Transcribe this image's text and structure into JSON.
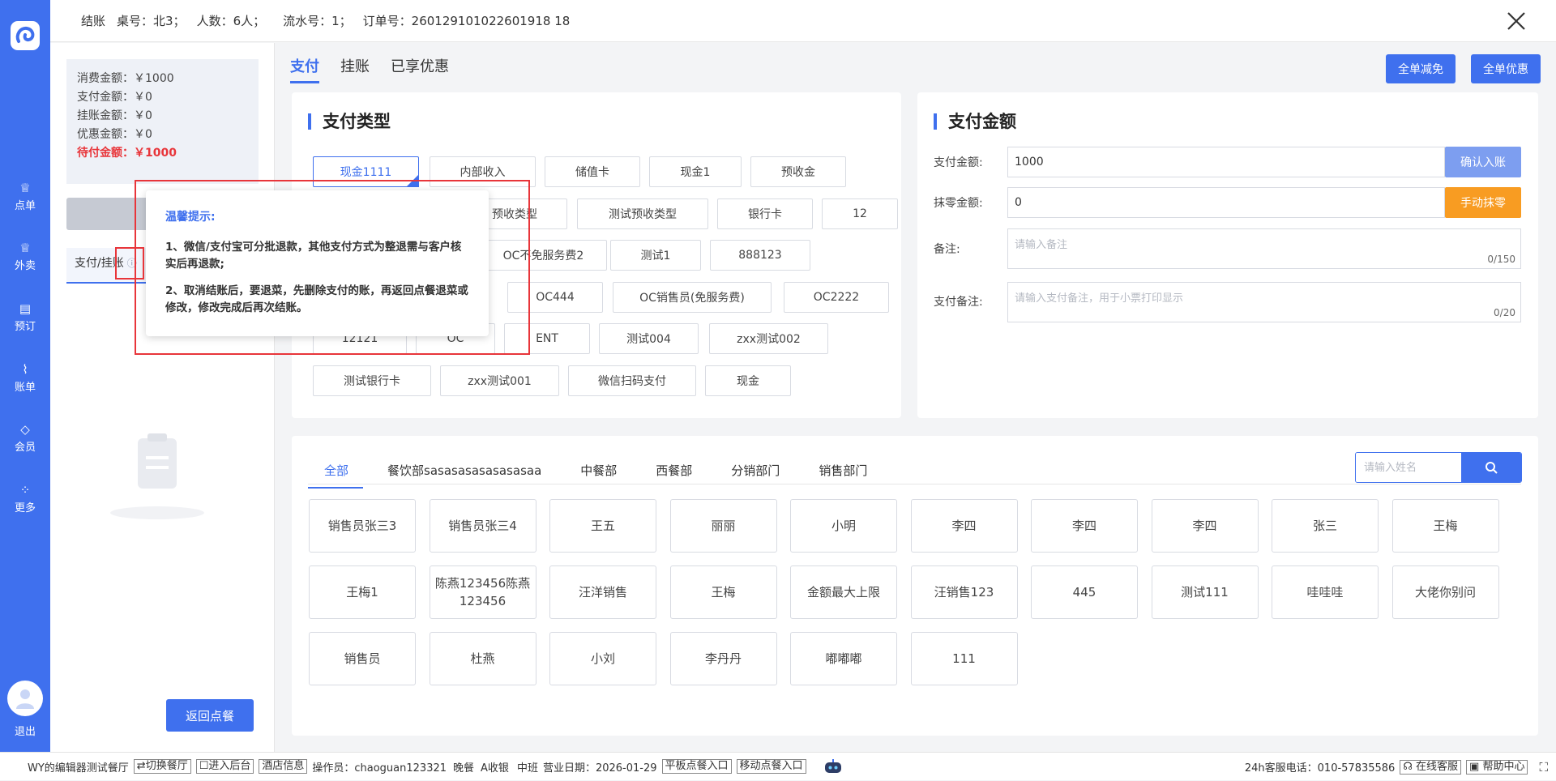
{
  "header": {
    "title": "结账",
    "table": "桌号：北3；",
    "guests": "人数：6人；",
    "serial": "流水号：1；",
    "order": "订单号：260129101022601918 18"
  },
  "rail": {
    "items": [
      {
        "label": "点单",
        "icon": "chef-hat-icon"
      },
      {
        "label": "外卖",
        "icon": "delivery-icon"
      },
      {
        "label": "预订",
        "icon": "reservation-icon"
      },
      {
        "label": "账单",
        "icon": "chart-icon"
      },
      {
        "label": "会员",
        "icon": "diamond-icon"
      },
      {
        "label": "更多",
        "icon": "grid-icon"
      }
    ],
    "logout": "退出"
  },
  "summary": {
    "consume": "消费金额：￥1000",
    "paid": "支付金额：￥0",
    "credit": "挂账金额：￥0",
    "discount": "优惠金额：￥0",
    "due": "待付金额：￥1000"
  },
  "left": {
    "tab_label": "支付/挂账",
    "back_button": "返回点餐"
  },
  "main_tabs": [
    "支付",
    "挂账",
    "已享优惠"
  ],
  "top_buttons": {
    "full_reduce": "全单减免",
    "full_discount": "全单优惠"
  },
  "pay_type": {
    "title": "支付类型",
    "buttons": [
      "现金1111",
      "内部收入",
      "储值卡",
      "现金1",
      "预收金",
      "预收类型",
      "测试预收类型",
      "银行卡",
      "12",
      "OC不免服务费2",
      "测试1",
      "888123",
      "OC444",
      "OC销售员(免服务费)",
      "OC2222",
      "12121",
      "OC",
      "ENT",
      "测试004",
      "zxx测试002",
      "测试银行卡",
      "zxx测试001",
      "微信扫码支付",
      "现金"
    ]
  },
  "pay_amount": {
    "title": "支付金额",
    "amount_label": "支付金额:",
    "amount_value": "1000",
    "confirm_button": "确认入账",
    "round_label": "抹零金额:",
    "round_value": "0",
    "round_button": "手动抹零",
    "remark_label": "备注:",
    "remark_placeholder": "请输入备注",
    "remark_counter": "0/150",
    "pay_remark_label": "支付备注:",
    "pay_remark_placeholder": "请输入支付备注，用于小票打印显示",
    "pay_remark_counter": "0/20"
  },
  "staff": {
    "tabs": [
      "全部",
      "餐饮部sasasasasasasasaa",
      "中餐部",
      "西餐部",
      "分销部门",
      "销售部门"
    ],
    "search_placeholder": "请输入姓名",
    "people": [
      "销售员张三3",
      "销售员张三4",
      "王五",
      "丽丽",
      "小明",
      "李四",
      "李四",
      "李四",
      "张三",
      "王梅",
      "王梅1",
      "陈燕123456陈燕123456",
      "汪洋销售",
      "王梅",
      "金额最大上限",
      "汪销售123",
      "445",
      "测试111",
      "哇哇哇",
      "大佬你别问",
      "销售员",
      "杜燕",
      "小刘",
      "李丹丹",
      "嘟嘟嘟",
      "111"
    ]
  },
  "tooltip": {
    "title": "温馨提示:",
    "line1": "1、微信/支付宝可分批退款，其他支付方式为整退需与客户核实后再退款;",
    "line2": "2、取消结账后，要退菜，先删除支付的账，再返回点餐退菜或修改，修改完成后再次结账。"
  },
  "statusbar": {
    "store": "WY的编辑器测试餐厅",
    "switch": "⇄切换餐厅",
    "backend": "☐进入后台",
    "hotel": "酒店信息",
    "operator": "操作员：chaoguan123321",
    "meal": "晚餐",
    "cashier": "A收银",
    "shift": "中班",
    "biz_date": "营业日期：2026-01-29",
    "tablet": "平板点餐入口",
    "mobile": "移动点餐入口",
    "hotline": "24h客服电话：010-57835586",
    "online": "在线客服",
    "help": "帮助中心"
  },
  "colors": {
    "primary": "#3f70ee",
    "danger": "#e8353a",
    "orange": "#f89c22"
  }
}
